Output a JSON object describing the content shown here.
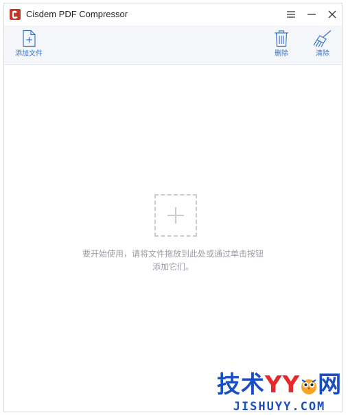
{
  "window": {
    "title": "Cisdem PDF Compressor"
  },
  "titlebar_icons": [
    "app-logo-icon",
    "menu-icon",
    "minimize-icon",
    "close-icon"
  ],
  "toolbar": {
    "add_file": {
      "label": "添加文件",
      "icon": "add-file-icon"
    },
    "delete": {
      "label": "删除",
      "icon": "trash-icon"
    },
    "clear": {
      "label": "清除",
      "icon": "broom-icon"
    }
  },
  "content": {
    "hint_line1": "要开始使用，请将文件拖放到此处或通过单击按钮",
    "hint_line2": "添加它们。",
    "drop_icon": "plus-icon"
  },
  "watermark": {
    "part1": "技术",
    "part2": "YY",
    "part3": "网",
    "domain": "JISHUYY.COM"
  },
  "colors": {
    "accent": "#3a75c4",
    "toolbar_bg": "#f4f6f9",
    "hint_text": "#9a9ea5",
    "drop_border": "#c8cbd0",
    "logo_red": "#c0392b"
  }
}
